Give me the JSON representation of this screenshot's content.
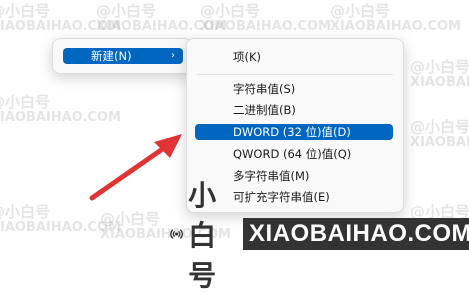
{
  "watermark": {
    "line1": "@小白号",
    "line2": "XIAOBAIHAO.COM"
  },
  "context_menu": {
    "parent_item": {
      "label": "新建(N)",
      "chevron": "›"
    },
    "submenu": {
      "items": [
        {
          "label": "项(K)"
        },
        {
          "label": "字符串值(S)"
        },
        {
          "label": "二进制值(B)"
        },
        {
          "label": "DWORD (32 位)值(D)",
          "highlighted": true
        },
        {
          "label": "QWORD (64 位)值(Q)"
        },
        {
          "label": "多字符串值(M)"
        },
        {
          "label": "可扩充字符串值(E)"
        }
      ]
    }
  },
  "annotation": {
    "arrow_color": "#e03434"
  },
  "footer": {
    "brand_cn": "小白号",
    "brand_en": "XIAOBAIHAO.COM"
  },
  "colors": {
    "highlight": "#0067c0",
    "menu_bg": "#f9f9f9"
  }
}
